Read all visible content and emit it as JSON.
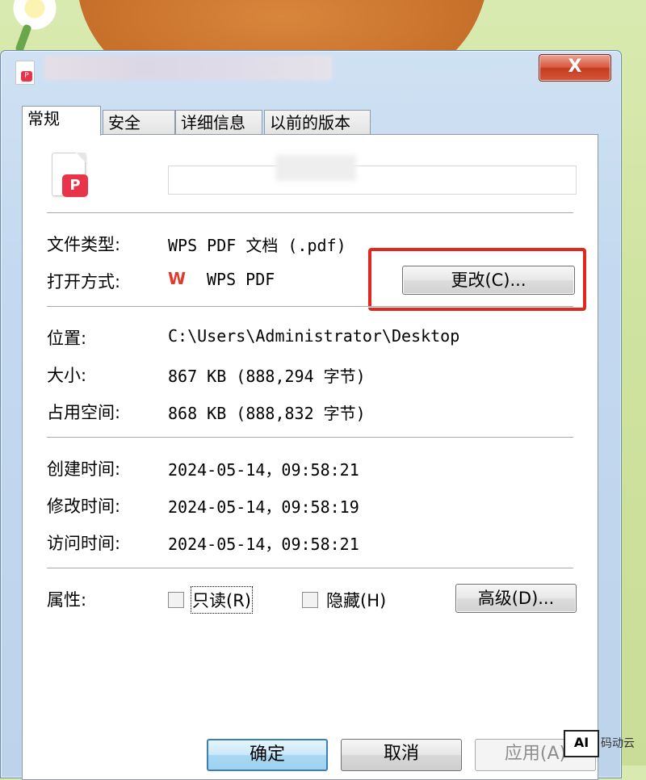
{
  "dialog": {
    "close_label": "X"
  },
  "tabs": [
    {
      "label": "常规"
    },
    {
      "label": "安全"
    },
    {
      "label": "详细信息"
    },
    {
      "label": "以前的版本"
    }
  ],
  "file_icon_glyph": "P",
  "wps_logo_glyph": "W",
  "fields": {
    "file_type_label": "文件类型:",
    "file_type_value": "WPS PDF 文档 (.pdf)",
    "open_with_label": "打开方式:",
    "open_with_value": "WPS PDF",
    "change_button": "更改(C)...",
    "location_label": "位置:",
    "location_value": "C:\\Users\\Administrator\\Desktop",
    "size_label": "大小:",
    "size_value": "867 KB (888,294 字节)",
    "size_on_disk_label": "占用空间:",
    "size_on_disk_value": "868 KB (888,832 字节)",
    "created_label": "创建时间:",
    "created_value": "2024-05-14，09:58:21",
    "modified_label": "修改时间:",
    "modified_value": "2024-05-14，09:58:19",
    "accessed_label": "访问时间:",
    "accessed_value": "2024-05-14，09:58:21",
    "attributes_label": "属性:",
    "readonly_label": "只读(R)",
    "readonly_checked": false,
    "hidden_label": "隐藏(H)",
    "hidden_checked": false,
    "advanced_button": "高级(D)..."
  },
  "buttons": {
    "ok": "确定",
    "cancel": "取消",
    "apply": "应用(A)"
  },
  "watermark": {
    "logo_text": "AI",
    "text": "码动云"
  },
  "colors": {
    "highlight": "#e0281f",
    "pdf_badge": "#e8334b",
    "wps_logo": "#e23a2a"
  }
}
